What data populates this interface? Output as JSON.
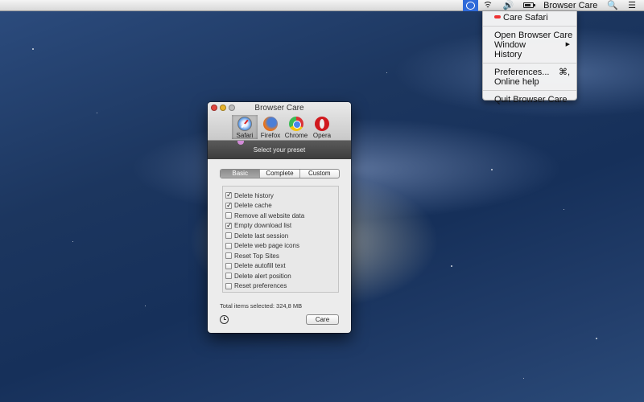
{
  "menubar": {
    "app_title": "Browser Care",
    "icons": [
      "browsercare-status-icon",
      "wifi-icon",
      "volume-icon",
      "battery-icon",
      "search-icon",
      "list-icon"
    ]
  },
  "menu": {
    "items": [
      {
        "label": "Care Safari"
      },
      {
        "label": "Open Browser Care"
      },
      {
        "label": "Window",
        "submenu": "▶"
      },
      {
        "label": "History"
      },
      {
        "label": "Preferences...",
        "shortcut": "⌘,"
      },
      {
        "label": "Online help"
      },
      {
        "label": "Quit Browser Care"
      }
    ]
  },
  "window": {
    "title": "Browser Care",
    "browsers": [
      {
        "label": "Safari",
        "icon": "safari-icon",
        "active": true
      },
      {
        "label": "Firefox",
        "icon": "firefox-icon",
        "active": false
      },
      {
        "label": "Chrome",
        "icon": "chrome-icon",
        "active": false
      },
      {
        "label": "Opera",
        "icon": "opera-icon",
        "active": false
      }
    ],
    "preset_header": "Select your preset",
    "tabs": [
      {
        "label": "Basic",
        "active": true
      },
      {
        "label": "Complete",
        "active": false
      },
      {
        "label": "Custom",
        "active": false
      }
    ],
    "options": [
      {
        "label": "Delete history",
        "checked": true
      },
      {
        "label": "Delete cache",
        "checked": true
      },
      {
        "label": "Remove all website data",
        "checked": false
      },
      {
        "label": "Empty download list",
        "checked": true
      },
      {
        "label": "Delete last session",
        "checked": false
      },
      {
        "label": "Delete web page icons",
        "checked": false
      },
      {
        "label": "Reset Top Sites",
        "checked": false
      },
      {
        "label": "Delete autofill text",
        "checked": false
      },
      {
        "label": "Delete alert position",
        "checked": false
      },
      {
        "label": "Reset preferences",
        "checked": false
      }
    ],
    "total_text": "Total items selected: 324,8 MB",
    "care_button": "Care"
  },
  "colors": {
    "accent": "#2f6ad9",
    "close": "#e2463f",
    "minimize": "#e7b32b",
    "preset_bar": "#4a4a4a"
  }
}
